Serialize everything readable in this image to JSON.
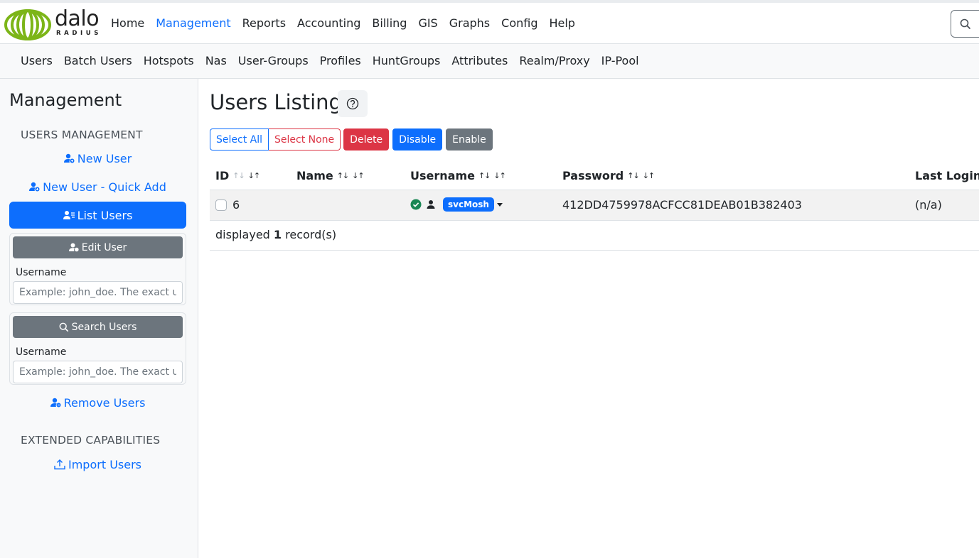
{
  "logo": {
    "main": "dalo",
    "sub": "RADIUS"
  },
  "topnav": [
    {
      "label": "Home",
      "active": false
    },
    {
      "label": "Management",
      "active": true
    },
    {
      "label": "Reports",
      "active": false
    },
    {
      "label": "Accounting",
      "active": false
    },
    {
      "label": "Billing",
      "active": false
    },
    {
      "label": "GIS",
      "active": false
    },
    {
      "label": "Graphs",
      "active": false
    },
    {
      "label": "Config",
      "active": false
    },
    {
      "label": "Help",
      "active": false
    }
  ],
  "subnav": [
    "Users",
    "Batch Users",
    "Hotspots",
    "Nas",
    "User-Groups",
    "Profiles",
    "HuntGroups",
    "Attributes",
    "Realm/Proxy",
    "IP-Pool"
  ],
  "sidebar": {
    "title": "Management",
    "users_section": "USERS MANAGEMENT",
    "new_user": "New User",
    "new_user_quick": "New User - Quick Add",
    "list_users": "List Users",
    "edit_user": {
      "button": "Edit User",
      "label": "Username",
      "placeholder": "Example: john_doe. The exact username"
    },
    "search_users": {
      "button": "Search Users",
      "label": "Username",
      "placeholder": "Example: john_doe. The exact username"
    },
    "remove_users": "Remove Users",
    "extended_section": "EXTENDED CAPABILITIES",
    "import_users": "Import Users"
  },
  "main": {
    "title": "Users Listing",
    "buttons": {
      "select_all": "Select All",
      "select_none": "Select None",
      "delete": "Delete",
      "disable": "Disable",
      "enable": "Enable"
    },
    "columns": [
      "ID",
      "Name",
      "Username",
      "Password",
      "Last Login T"
    ],
    "rows": [
      {
        "id": "6",
        "name": "",
        "username": "svcMosh",
        "password": "412DD4759978ACFCC81DEAB01B382403",
        "last_login": "(n/a)"
      }
    ],
    "footer": {
      "prefix": "displayed ",
      "count": "1",
      "suffix": " record(s)"
    }
  },
  "colors": {
    "primary": "#0d6efd",
    "danger": "#dc3545",
    "secondary": "#6c757d",
    "success": "#198754",
    "logo_green": "#7cb518"
  }
}
